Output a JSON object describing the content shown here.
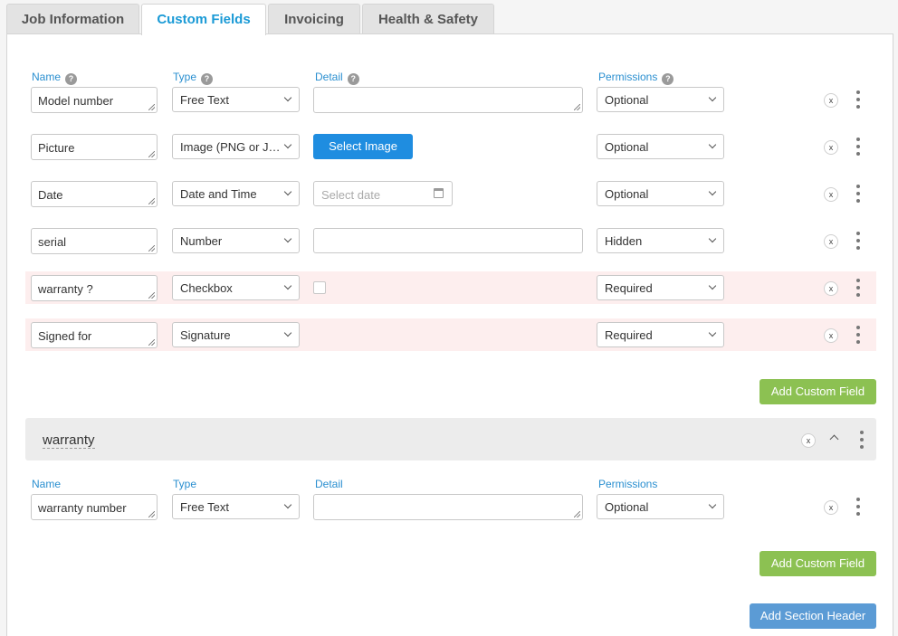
{
  "tabs": [
    {
      "label": "Job Information"
    },
    {
      "label": "Custom Fields"
    },
    {
      "label": "Invoicing"
    },
    {
      "label": "Health & Safety"
    }
  ],
  "columns": {
    "name": "Name",
    "type": "Type",
    "detail": "Detail",
    "permissions": "Permissions"
  },
  "fields": [
    {
      "name": "Model number",
      "type": "Free Text",
      "permission": "Optional"
    },
    {
      "name": "Picture",
      "type": "Image (PNG or J…",
      "detail_button": "Select Image",
      "permission": "Optional"
    },
    {
      "name": "Date",
      "type": "Date and Time",
      "detail_placeholder": "Select date",
      "permission": "Optional"
    },
    {
      "name": "serial",
      "type": "Number",
      "permission": "Hidden"
    },
    {
      "name": "warranty ?",
      "type": "Checkbox",
      "permission": "Required"
    },
    {
      "name": "Signed for",
      "type": "Signature",
      "permission": "Required"
    }
  ],
  "add_custom_field_label": "Add Custom Field",
  "section": {
    "title": "warranty",
    "fields": [
      {
        "name": "warranty number",
        "type": "Free Text",
        "permission": "Optional"
      }
    ]
  },
  "add_section_header_label": "Add Section Header",
  "icons": {
    "close": "x",
    "help": "?"
  },
  "colors": {
    "accent": "#1a9ad6",
    "green": "#8cc152",
    "blue_button": "#5b9bd5",
    "required_row": "#fdeeee"
  }
}
